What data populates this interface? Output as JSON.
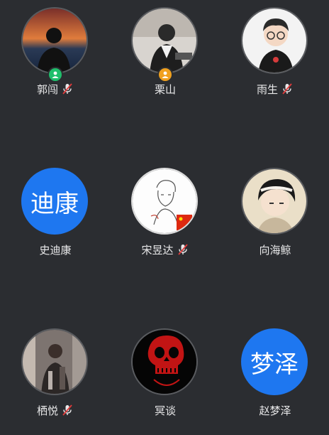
{
  "participants": [
    {
      "name": "郭闯",
      "muted": true,
      "avatar_type": "photo",
      "badge": "member-badge",
      "badge_color": "#1fbf6b"
    },
    {
      "name": "栗山",
      "muted": false,
      "avatar_type": "photo",
      "badge": "member-badge",
      "badge_color": "#f0a01e"
    },
    {
      "name": "雨生",
      "muted": true,
      "avatar_type": "photo"
    },
    {
      "name": "史迪康",
      "muted": false,
      "avatar_type": "text",
      "avatar_text": "迪康",
      "avatar_color": "#1e77f0"
    },
    {
      "name": "宋昱达",
      "muted": true,
      "avatar_type": "photo"
    },
    {
      "name": "向海鲸",
      "muted": false,
      "avatar_type": "photo"
    },
    {
      "name": "栖悦",
      "muted": true,
      "avatar_type": "photo"
    },
    {
      "name": "冥谈",
      "muted": false,
      "avatar_type": "photo"
    },
    {
      "name": "赵梦泽",
      "muted": false,
      "avatar_type": "text",
      "avatar_text": "梦泽",
      "avatar_color": "#1e77f0"
    }
  ],
  "colors": {
    "background": "#2b2d31",
    "mute_slash": "#e23b3b",
    "avatar_text_bg": "#1e77f0"
  }
}
